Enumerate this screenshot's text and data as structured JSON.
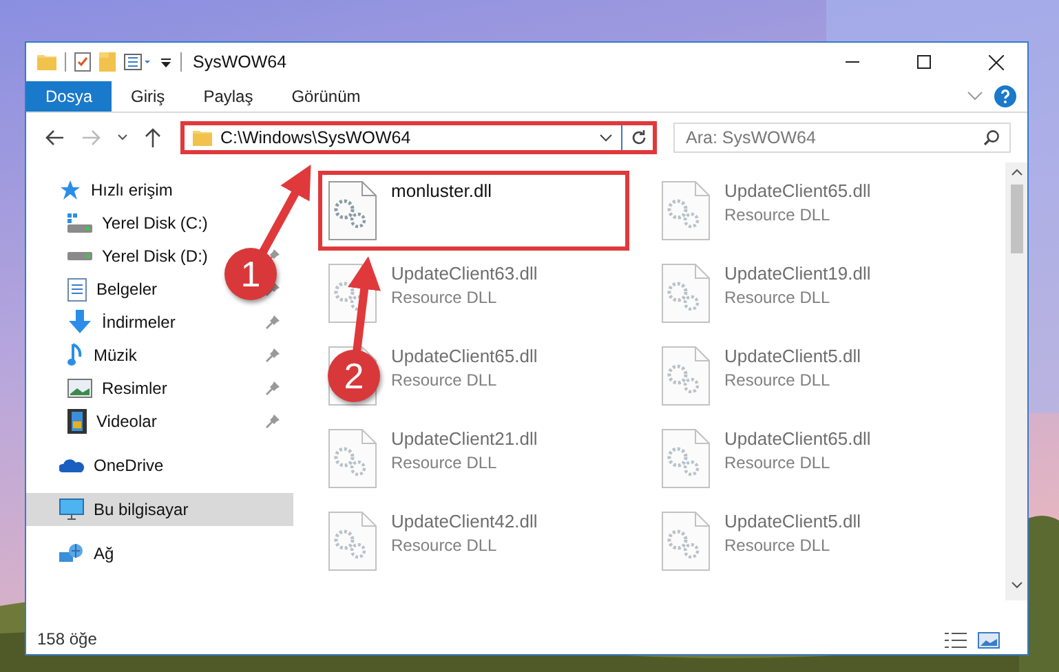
{
  "window": {
    "title": "SysWOW64"
  },
  "ribbon_tabs": [
    {
      "label": "Dosya",
      "selected": true
    },
    {
      "label": "Giriş",
      "selected": false
    },
    {
      "label": "Paylaş",
      "selected": false
    },
    {
      "label": "Görünüm",
      "selected": false
    }
  ],
  "address_bar": {
    "path": "C:\\Windows\\SysWOW64",
    "highlighted": true
  },
  "search": {
    "placeholder": "Ara: SysWOW64"
  },
  "sidebar": {
    "items": [
      {
        "label": "Hızlı erişim",
        "kind": "star",
        "selected": false,
        "children": [
          {
            "label": "Yerel Disk (C:)",
            "kind": "drive-c",
            "pinned": false,
            "selected": false
          },
          {
            "label": "Yerel Disk (D:)",
            "kind": "drive",
            "pinned": true,
            "selected": false
          },
          {
            "label": "Belgeler",
            "kind": "document",
            "pinned": true,
            "selected": false
          },
          {
            "label": "İndirmeler",
            "kind": "download",
            "pinned": true,
            "selected": false
          },
          {
            "label": "Müzik",
            "kind": "music",
            "pinned": true,
            "selected": false
          },
          {
            "label": "Resimler",
            "kind": "pictures",
            "pinned": true,
            "selected": false
          },
          {
            "label": "Videolar",
            "kind": "video",
            "pinned": true,
            "selected": false
          }
        ]
      },
      {
        "label": "OneDrive",
        "kind": "cloud",
        "selected": false
      },
      {
        "label": "Bu bilgisayar",
        "kind": "computer",
        "selected": true
      },
      {
        "label": "Ağ",
        "kind": "network",
        "selected": false
      }
    ]
  },
  "files": [
    {
      "name": "monluster.dll",
      "highlighted": true,
      "dimmed": false
    },
    {
      "name": "UpdateClient65.dll",
      "type": "Resource DLL",
      "highlighted": false,
      "dimmed": true
    },
    {
      "name": "UpdateClient63.dll",
      "type": "Resource DLL",
      "highlighted": false,
      "dimmed": true
    },
    {
      "name": "UpdateClient19.dll",
      "type": "Resource DLL",
      "highlighted": false,
      "dimmed": true
    },
    {
      "name": "UpdateClient65.dll",
      "type": "Resource DLL",
      "highlighted": false,
      "dimmed": true
    },
    {
      "name": "UpdateClient5.dll",
      "type": "Resource DLL",
      "highlighted": false,
      "dimmed": true
    },
    {
      "name": "UpdateClient21.dll",
      "type": "Resource DLL",
      "highlighted": false,
      "dimmed": true
    },
    {
      "name": "UpdateClient65.dll",
      "type": "Resource DLL",
      "highlighted": false,
      "dimmed": true
    },
    {
      "name": "UpdateClient42.dll",
      "type": "Resource DLL",
      "highlighted": false,
      "dimmed": true
    },
    {
      "name": "UpdateClient5.dll",
      "type": "Resource DLL",
      "highlighted": false,
      "dimmed": true
    }
  ],
  "status_bar": {
    "count": "158 öğe"
  },
  "callouts": [
    {
      "label": "1"
    },
    {
      "label": "2"
    }
  ]
}
